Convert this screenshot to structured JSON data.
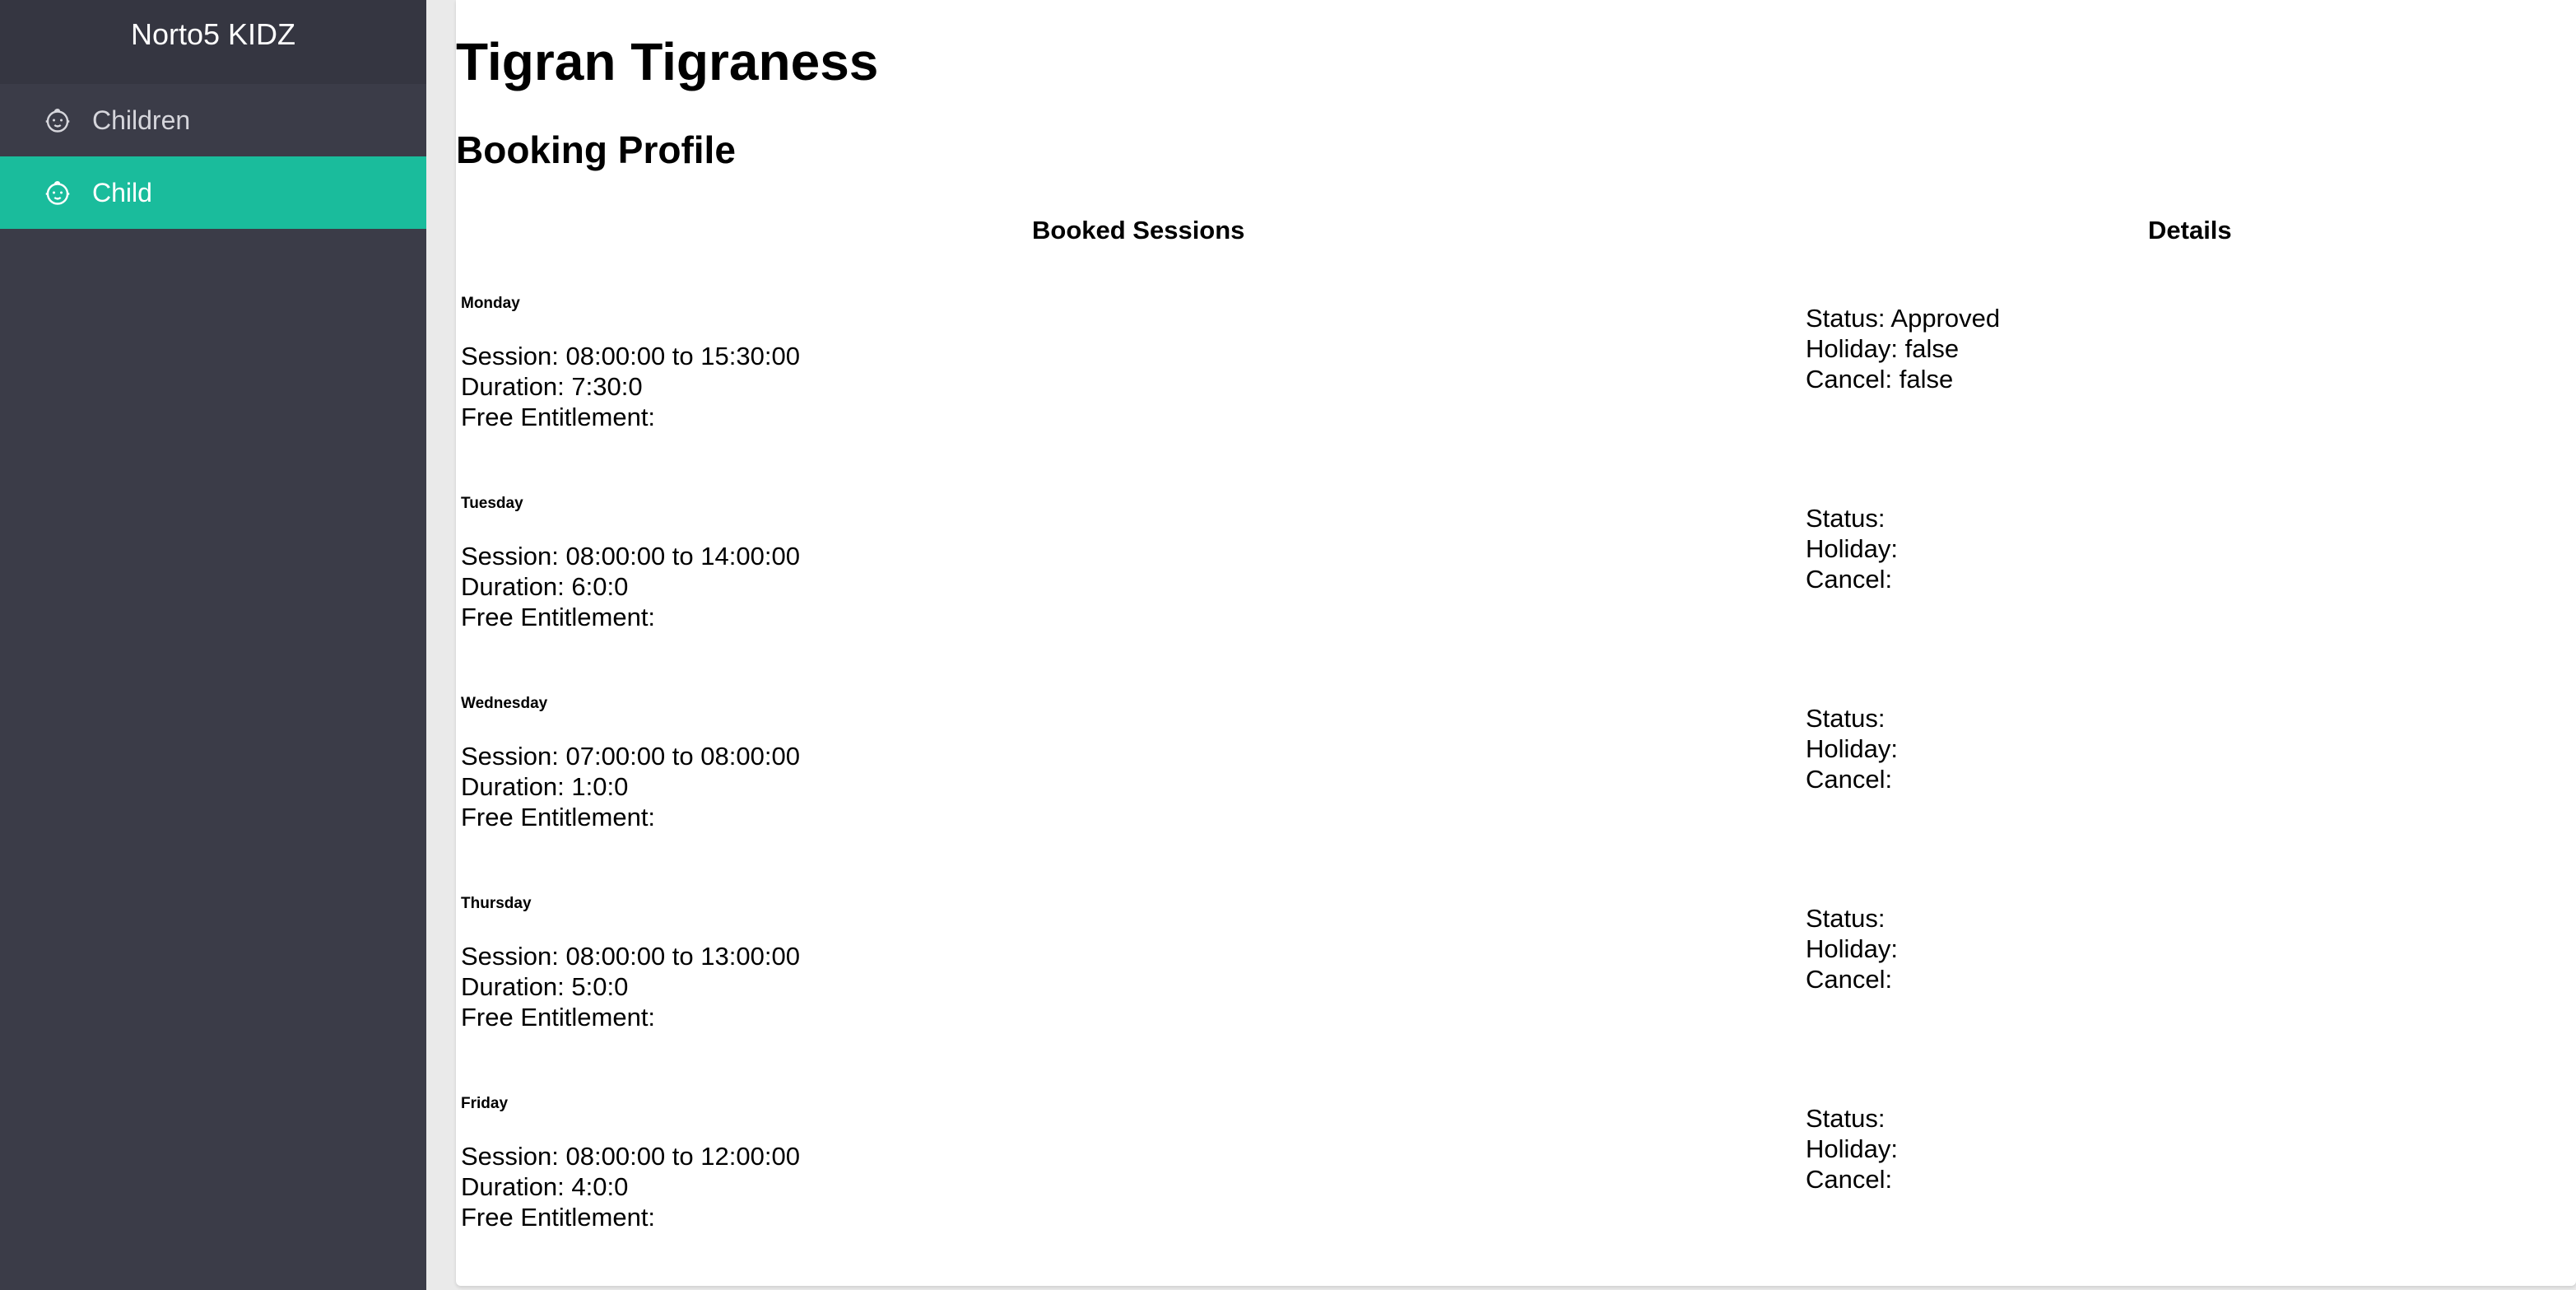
{
  "sidebar": {
    "brand": "Norto5 KIDZ",
    "items": [
      {
        "label": "Children",
        "icon": "child-face-icon",
        "active": false
      },
      {
        "label": "Child",
        "icon": "child-face-icon",
        "active": true
      }
    ],
    "accent_color": "#1abc9c"
  },
  "main": {
    "child_name": "Tigran Tigraness",
    "section_title": "Booking Profile",
    "headers": {
      "sessions": "Booked Sessions",
      "details": "Details"
    },
    "bookings": [
      {
        "day": "Monday",
        "session": "Session: 08:00:00 to 15:30:00",
        "duration": "Duration: 7:30:0",
        "entitlement": "Free Entitlement:",
        "status": "Status: Approved",
        "holiday": "Holiday: false",
        "cancel": "Cancel: false"
      },
      {
        "day": "Tuesday",
        "session": "Session: 08:00:00 to 14:00:00",
        "duration": "Duration: 6:0:0",
        "entitlement": "Free Entitlement:",
        "status": "Status:",
        "holiday": "Holiday:",
        "cancel": "Cancel:"
      },
      {
        "day": "Wednesday",
        "session": "Session: 07:00:00 to 08:00:00",
        "duration": "Duration: 1:0:0",
        "entitlement": "Free Entitlement:",
        "status": "Status:",
        "holiday": "Holiday:",
        "cancel": "Cancel:"
      },
      {
        "day": "Thursday",
        "session": "Session: 08:00:00 to 13:00:00",
        "duration": "Duration: 5:0:0",
        "entitlement": "Free Entitlement:",
        "status": "Status:",
        "holiday": "Holiday:",
        "cancel": "Cancel:"
      },
      {
        "day": "Friday",
        "session": "Session: 08:00:00 to 12:00:00",
        "duration": "Duration: 4:0:0",
        "entitlement": "Free Entitlement:",
        "status": "Status:",
        "holiday": "Holiday:",
        "cancel": "Cancel:"
      }
    ]
  }
}
